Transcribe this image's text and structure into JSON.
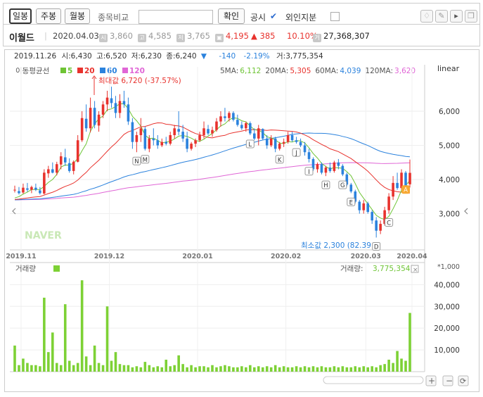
{
  "toolbar": {
    "buttons": [
      "일봉",
      "주봉",
      "월봉"
    ],
    "compare_label": "종목비교",
    "confirm_label": "확인",
    "disclosure_label": "공시",
    "foreign_label": "외인지분"
  },
  "stock": {
    "name": "이월드",
    "date": "2020.04.03",
    "open": "3,860",
    "high": "4,585",
    "low": "3,765",
    "close": "4,195",
    "change": "▲ 385",
    "change_pct": "10.10%",
    "volume": "27,368,307",
    "open_badge": "시",
    "high_badge": "고",
    "low_badge": "저",
    "volume_badge": "거"
  },
  "colors": {
    "up": "#e8322d",
    "down": "#2b82dd",
    "ma5": "#6ec435",
    "ma20": "#e8322d",
    "ma60": "#2b82dd",
    "ma120": "#e066d6",
    "volume": "#7dd135"
  },
  "chart_data": {
    "type": "candlestick",
    "hover_info": {
      "date": "2019.11.26",
      "open_label": "시:",
      "open": "6,430",
      "high_label": "고:",
      "high": "6,520",
      "low_label": "저:",
      "low": "6,230",
      "close_label": "종:",
      "close": "6,240",
      "change": "-140",
      "change_pct": "-2.19%",
      "volume_label": "거:",
      "volume": "3,775,354",
      "arrow": "▼"
    },
    "ma_label": "이동평균선",
    "ma_legend": [
      {
        "period": "5",
        "color": "#6ec435"
      },
      {
        "period": "20",
        "color": "#e8322d"
      },
      {
        "period": "60",
        "color": "#2b82dd"
      },
      {
        "period": "120",
        "color": "#e066d6"
      }
    ],
    "ma_values": [
      {
        "label": "5MA:",
        "value": "6,112",
        "color": "#6ec435"
      },
      {
        "label": "20MA:",
        "value": "5,305",
        "color": "#e8322d"
      },
      {
        "label": "60MA:",
        "value": "4,039",
        "color": "#2b82dd"
      },
      {
        "label": "120MA:",
        "value": "3,620",
        "color": "#e066d6"
      }
    ],
    "scale_label": "linear",
    "y_ticks": [
      3000,
      4000,
      5000,
      6000
    ],
    "y_tick_labels": [
      "3,000",
      "4,000",
      "5,000",
      "6,000"
    ],
    "x_ticks": [
      "2019.11",
      "2019.12",
      "2020.01",
      "2020.02",
      "2020.03",
      "2020.04"
    ],
    "max_annotation": "최대값 6,720 (-37.57%)",
    "min_annotation": "최소값 2,300 (82.39",
    "watermark": "NAVER",
    "pattern_labels": [
      "N",
      "M",
      "L",
      "K",
      "J",
      "I",
      "H",
      "G",
      "E",
      "D",
      "C",
      "A"
    ],
    "candles_ohlc": [
      [
        3700,
        3820,
        3620,
        3700
      ],
      [
        3660,
        3780,
        3560,
        3600
      ],
      [
        3620,
        3880,
        3580,
        3760
      ],
      [
        3740,
        3900,
        3640,
        3700
      ],
      [
        3700,
        3820,
        3600,
        3780
      ],
      [
        3760,
        3880,
        3660,
        3700
      ],
      [
        3680,
        3780,
        3560,
        3600
      ],
      [
        3590,
        4300,
        3560,
        4200
      ],
      [
        4180,
        4400,
        4050,
        4300
      ],
      [
        4300,
        4500,
        4180,
        4200
      ],
      [
        4200,
        4520,
        4120,
        4450
      ],
      [
        4440,
        4800,
        4300,
        4680
      ],
      [
        4650,
        4900,
        4400,
        4500
      ],
      [
        4480,
        4620,
        4200,
        4250
      ],
      [
        4250,
        4560,
        4150,
        4520
      ],
      [
        4520,
        5300,
        4500,
        5150
      ],
      [
        5150,
        6000,
        5100,
        5800
      ],
      [
        5780,
        6200,
        5400,
        5500
      ],
      [
        5500,
        6400,
        5380,
        6100
      ],
      [
        6100,
        6300,
        5500,
        5600
      ],
      [
        5580,
        6000,
        5400,
        5900
      ],
      [
        5900,
        6300,
        5800,
        6200
      ],
      [
        6200,
        6600,
        6000,
        6400
      ],
      [
        6380,
        6720,
        6100,
        6240
      ],
      [
        6240,
        6450,
        5800,
        5950
      ],
      [
        5950,
        6500,
        5800,
        6300
      ],
      [
        6300,
        6600,
        6100,
        6200
      ],
      [
        6200,
        6400,
        5600,
        5700
      ],
      [
        5680,
        5800,
        4900,
        5100
      ],
      [
        5100,
        5400,
        4800,
        5300
      ],
      [
        5300,
        5800,
        5100,
        5500
      ],
      [
        5480,
        5550,
        4850,
        4900
      ],
      [
        4900,
        5300,
        4800,
        5200
      ],
      [
        5200,
        5500,
        5000,
        5150
      ],
      [
        5150,
        5300,
        4900,
        5000
      ],
      [
        5000,
        5200,
        4950,
        5100
      ],
      [
        5100,
        5250,
        5000,
        5050
      ],
      [
        5050,
        5400,
        5000,
        5300
      ],
      [
        5300,
        5600,
        5200,
        5500
      ],
      [
        5480,
        6000,
        5300,
        5400
      ],
      [
        5400,
        5600,
        5100,
        5200
      ],
      [
        5200,
        5400,
        4800,
        4900
      ],
      [
        4900,
        5100,
        4850,
        5050
      ],
      [
        5050,
        5200,
        4950,
        5150
      ],
      [
        5150,
        5400,
        5100,
        5300
      ],
      [
        5300,
        5700,
        5200,
        5500
      ],
      [
        5480,
        5600,
        5300,
        5350
      ],
      [
        5350,
        5550,
        5250,
        5450
      ],
      [
        5450,
        5800,
        5400,
        5700
      ],
      [
        5700,
        6000,
        5550,
        5850
      ],
      [
        5850,
        6100,
        5700,
        5800
      ],
      [
        5800,
        6000,
        5700,
        5950
      ],
      [
        5950,
        6000,
        5700,
        5750
      ],
      [
        5750,
        5900,
        5550,
        5600
      ],
      [
        5600,
        5700,
        5450,
        5500
      ],
      [
        5500,
        5700,
        5400,
        5650
      ],
      [
        5650,
        5700,
        5300,
        5350
      ],
      [
        5350,
        5500,
        5150,
        5200
      ],
      [
        5200,
        5600,
        5000,
        5500
      ],
      [
        5480,
        5500,
        5150,
        5200
      ],
      [
        5200,
        5300,
        4900,
        5000
      ],
      [
        5000,
        5300,
        4950,
        5200
      ],
      [
        5200,
        5250,
        4800,
        4900
      ],
      [
        4900,
        5100,
        4850,
        5050
      ],
      [
        5050,
        5200,
        4950,
        5100
      ],
      [
        5100,
        5400,
        5050,
        5300
      ],
      [
        5300,
        5400,
        5100,
        5150
      ],
      [
        5150,
        5250,
        5050,
        5100
      ],
      [
        5100,
        5200,
        4950,
        5000
      ],
      [
        5000,
        5100,
        4700,
        4800
      ],
      [
        4800,
        4900,
        4500,
        4600
      ],
      [
        4600,
        4650,
        4250,
        4300
      ],
      [
        4300,
        4500,
        4200,
        4450
      ],
      [
        4450,
        4500,
        4150,
        4200
      ],
      [
        4200,
        4400,
        4100,
        4350
      ],
      [
        4350,
        4500,
        4200,
        4250
      ],
      [
        4250,
        4550,
        4200,
        4500
      ],
      [
        4500,
        4600,
        4300,
        4400
      ],
      [
        4400,
        4450,
        4100,
        4150
      ],
      [
        4150,
        4200,
        3800,
        3850
      ],
      [
        3850,
        3900,
        3600,
        3650
      ],
      [
        3650,
        3700,
        3300,
        3350
      ],
      [
        3350,
        3400,
        3000,
        3100
      ],
      [
        3100,
        3400,
        3000,
        3300
      ],
      [
        3300,
        3350,
        3000,
        3050
      ],
      [
        3050,
        3100,
        2700,
        2800
      ],
      [
        2800,
        2900,
        2300,
        2500
      ],
      [
        2500,
        2800,
        2400,
        2700
      ],
      [
        2700,
        3200,
        2650,
        3100
      ],
      [
        3100,
        3600,
        3000,
        3500
      ],
      [
        3500,
        4100,
        3400,
        3900
      ],
      [
        3900,
        4200,
        3700,
        3750
      ],
      [
        3750,
        4300,
        3700,
        4200
      ],
      [
        4200,
        4250,
        3750,
        3800
      ],
      [
        3860,
        4585,
        3765,
        4195
      ]
    ],
    "volume_label": "거래량",
    "volume_value_label": "거래량:",
    "volume_value": "3,775,354",
    "volume_unit": "*1,000",
    "volume_y_ticks": [
      10000,
      20000,
      30000,
      40000
    ],
    "volume_y_tick_labels": [
      "10,000",
      "20,000",
      "30,000",
      "40,000"
    ],
    "volumes": [
      12000,
      3000,
      6000,
      4000,
      3000,
      3000,
      2500,
      34000,
      9000,
      18000,
      4000,
      3000,
      31000,
      5000,
      3000,
      4000,
      42000,
      7000,
      3000,
      12000,
      4000,
      3000,
      30000,
      5000,
      9000,
      3500,
      3000,
      3000,
      2000,
      2500,
      2000,
      4500,
      3000,
      2000,
      2500,
      2000,
      5500,
      2500,
      3000,
      7500,
      3500,
      2000,
      3000,
      2000,
      2500,
      2500,
      2000,
      3000,
      2000,
      2500,
      3000,
      2500,
      2000,
      2000,
      2500,
      2000,
      3000,
      2000,
      2500,
      2000,
      2500,
      2000,
      3000,
      2000,
      2500,
      2000,
      2000,
      2500,
      2000,
      2500,
      2000,
      2500,
      2000,
      2500,
      2000,
      2000,
      2500,
      2000,
      2500,
      2000,
      2000,
      2500,
      2000,
      2500,
      2000,
      2500,
      2000,
      3000,
      3500,
      5500,
      4000,
      9500,
      6000,
      5000,
      27000
    ]
  }
}
